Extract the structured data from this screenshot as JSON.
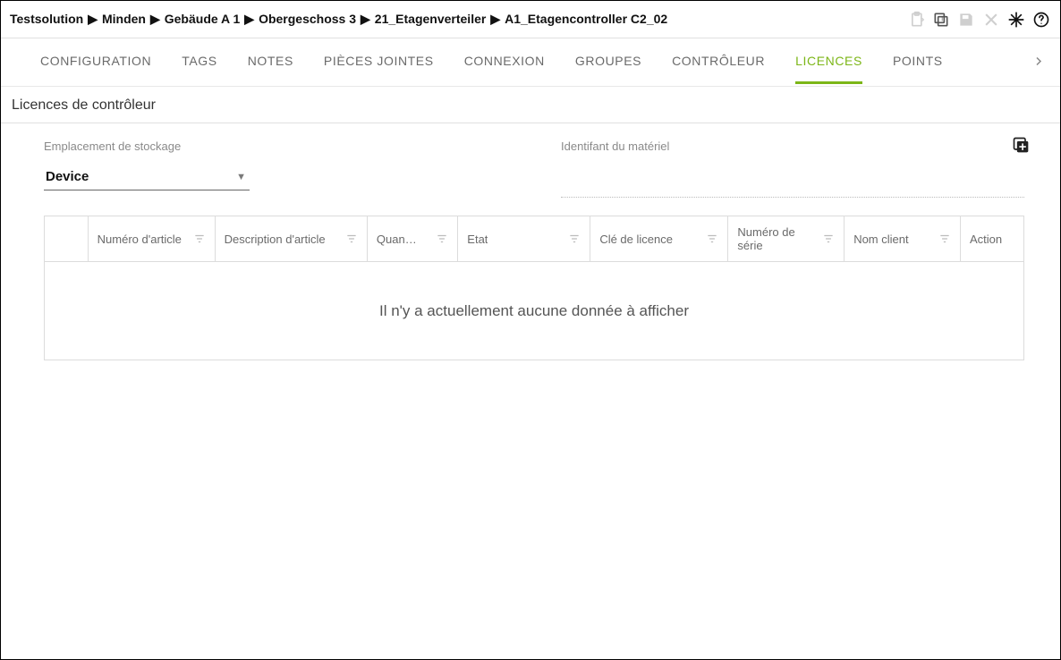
{
  "breadcrumb": [
    "Testsolution",
    "Minden",
    "Gebäude A 1",
    "Obergeschoss 3",
    "21_Etagenverteiler",
    "A1_Etagencontroller C2_02"
  ],
  "toolbar_icons": {
    "paste": "paste-icon",
    "copy": "copy-icon",
    "save": "save-icon",
    "close": "close-icon",
    "burst": "snowflake-icon",
    "help": "help-icon"
  },
  "tabs": {
    "items": [
      "CONFIGURATION",
      "TAGS",
      "NOTES",
      "PIÈCES JOINTES",
      "CONNEXION",
      "GROUPES",
      "CONTRÔLEUR",
      "LICENCES",
      "POINTS"
    ],
    "active_index": 7
  },
  "section_title": "Licences de contrôleur",
  "fields": {
    "storage_label": "Emplacement de stockage",
    "storage_value": "Device",
    "hw_id_label": "Identifant du matériel"
  },
  "table": {
    "columns": [
      "",
      "Numéro d'article",
      "Description d'article",
      "Quan…",
      "Etat",
      "Clé de licence",
      "Numéro de série",
      "Nom client",
      "Action"
    ],
    "filterable": [
      false,
      true,
      true,
      true,
      true,
      true,
      true,
      true,
      false
    ],
    "empty_message": "Il n'y a actuellement aucune donnée à afficher"
  }
}
